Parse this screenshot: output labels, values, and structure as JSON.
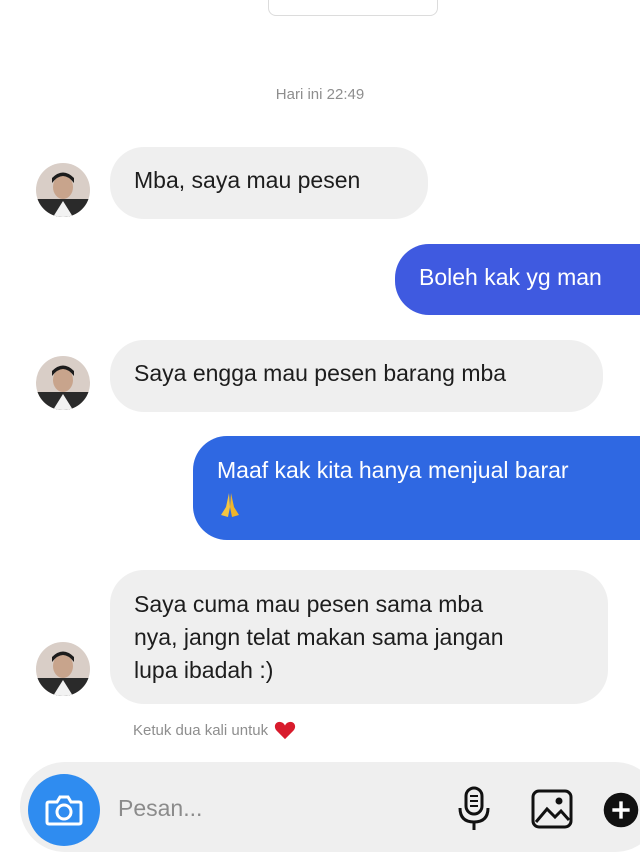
{
  "thread": {
    "timestamp": "Hari ini 22:49",
    "messages": [
      {
        "side": "in",
        "lines": [
          "Mba, saya mau pesen"
        ]
      },
      {
        "side": "out",
        "lines": [
          "Boleh kak yg man"
        ]
      },
      {
        "side": "in",
        "lines": [
          "Saya engga mau pesen barang mba"
        ]
      },
      {
        "side": "out",
        "lines": [
          "Maaf kak kita hanya menjual barar"
        ]
      },
      {
        "side": "in",
        "lines": [
          "Saya cuma mau pesen sama mba",
          "nya, jangn telat makan sama jangan",
          "lupa ibadah :)"
        ]
      }
    ],
    "like_hint": "Ketuk dua kali untuk"
  },
  "composer": {
    "placeholder": "Pesan..."
  },
  "colors": {
    "outgoing_1": "#3f5ae0",
    "outgoing_2": "#2f68e2",
    "incoming": "#efefef",
    "camera": "#2f8cf0",
    "heart": "#d81b2c"
  },
  "icons": [
    "camera-icon",
    "microphone-icon",
    "gallery-icon",
    "plus-icon",
    "heart-icon",
    "pray-emoji"
  ]
}
